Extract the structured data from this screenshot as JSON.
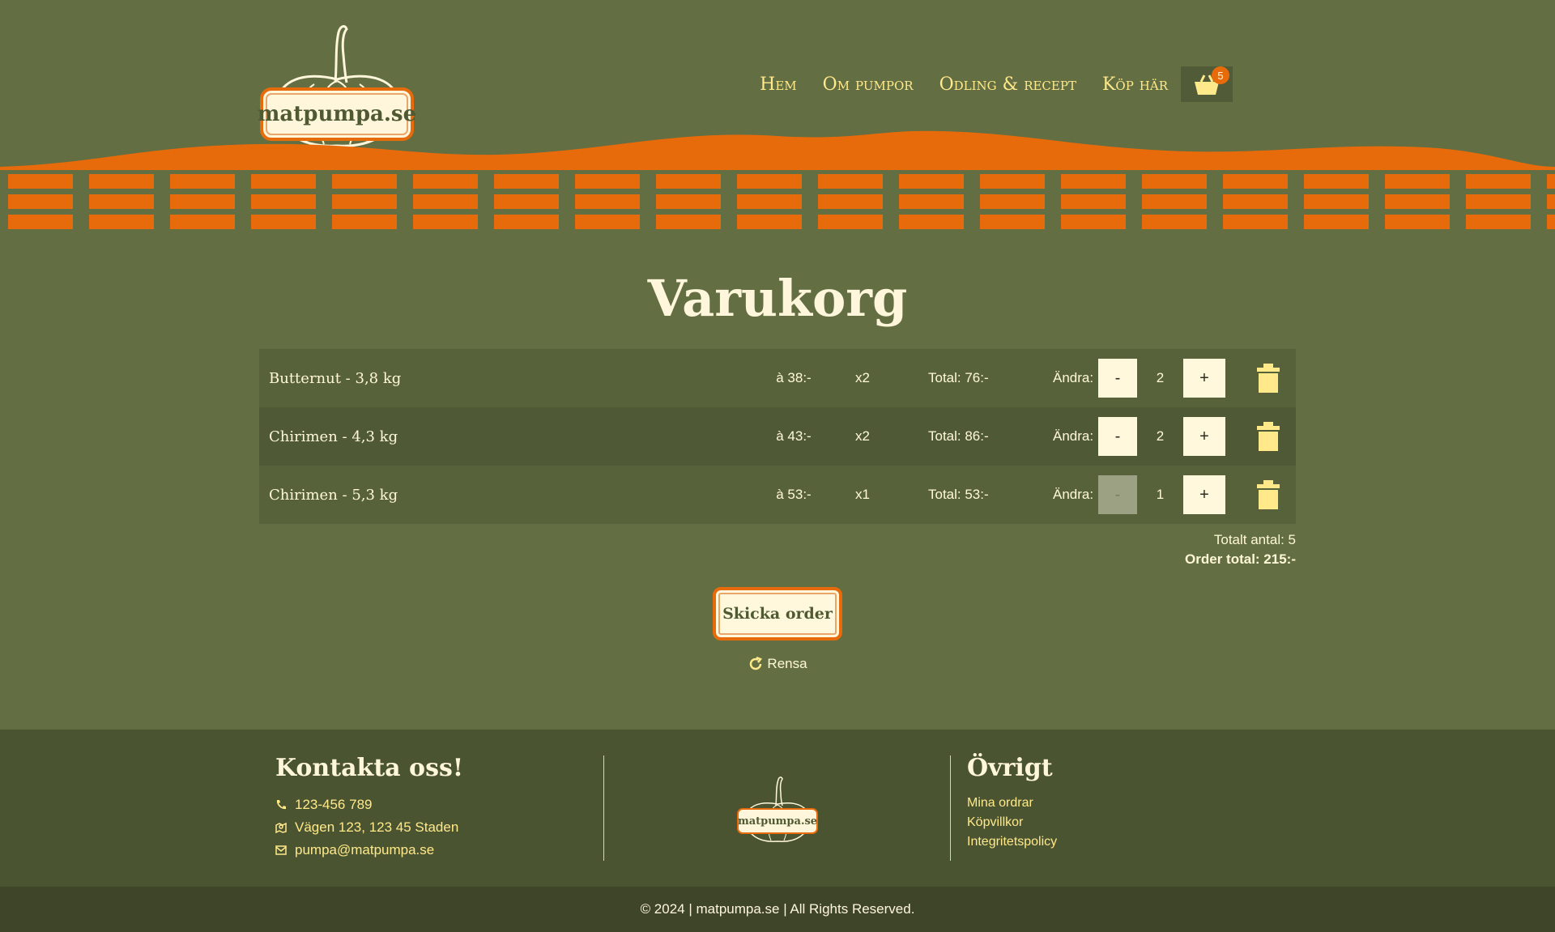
{
  "brand": {
    "logo_text": "matpumpa.se"
  },
  "nav": {
    "items": [
      "Hem",
      "Om pumpor",
      "Odling & recept",
      "Köp här"
    ],
    "cart_count": "5"
  },
  "page_title": "Varukorg",
  "cart": {
    "change_label": "Ändra:",
    "items": [
      {
        "name": "Butternut - 3,8 kg",
        "price": "à 38:-",
        "qty": "x2",
        "total": "Total: 76:-",
        "count": "2",
        "minus": "-",
        "plus": "+"
      },
      {
        "name": "Chirimen - 4,3 kg",
        "price": "à 43:-",
        "qty": "x2",
        "total": "Total: 86:-",
        "count": "2",
        "minus": "-",
        "plus": "+"
      },
      {
        "name": "Chirimen - 5,3 kg",
        "price": "à 53:-",
        "qty": "x1",
        "total": "Total: 53:-",
        "count": "1",
        "minus": "-",
        "plus": "+"
      }
    ],
    "total_count": "Totalt antal: 5",
    "order_total": "Order total: 215:-",
    "send_label": "Skicka order",
    "clear_label": "Rensa"
  },
  "footer": {
    "contact_title": "Kontakta oss!",
    "phone": "123-456 789",
    "address": "Vägen 123, 123 45 Staden",
    "email": "pumpa@matpumpa.se",
    "other_title": "Övrigt",
    "links": [
      "Mina ordrar",
      "Köpvillkor",
      "Integritetspolicy"
    ],
    "logo_text": "matpumpa.se",
    "copyright": "© 2024 | matpumpa.se | All Rights Reserved."
  },
  "colors": {
    "background": "#636e42",
    "accent_orange": "#e86b0b",
    "cream": "#fff6dc",
    "nav_yellow": "#ffe98a",
    "footer": "#4b5431"
  }
}
